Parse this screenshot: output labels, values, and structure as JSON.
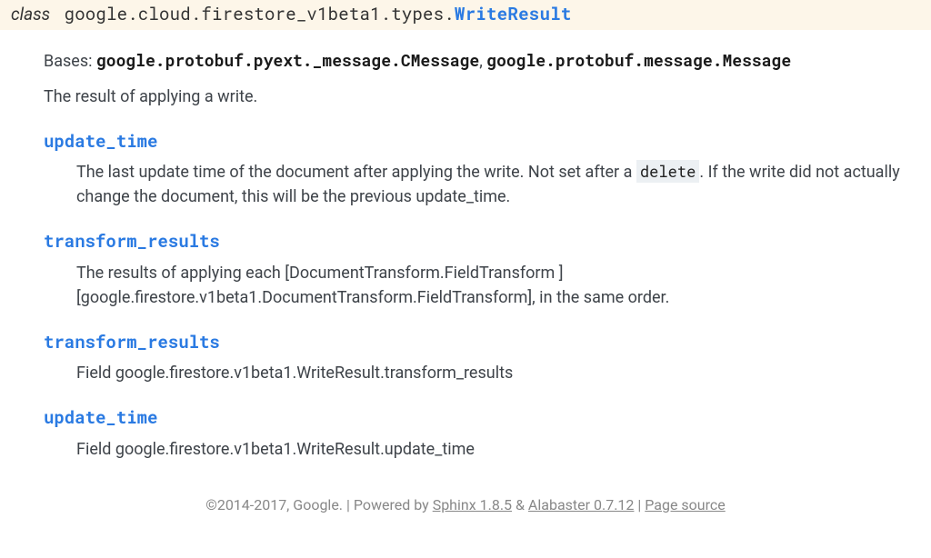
{
  "class_header": {
    "prefix": "class",
    "module_path": "google.cloud.firestore_v1beta1.types.",
    "class_name": "WriteResult"
  },
  "bases": {
    "label": "Bases:",
    "items": [
      "google.protobuf.pyext._message.CMessage",
      "google.protobuf.message.Message"
    ],
    "separator": ", "
  },
  "class_description": "The result of applying a write.",
  "attributes": [
    {
      "name": "update_time",
      "description_pre": "The last update time of the document after applying the write. Not set after a ",
      "literal": "delete",
      "description_post": ". If the write did not actually change the document, this will be the previous update_time."
    },
    {
      "name": "transform_results",
      "description": "The results of applying each [DocumentTransform.FieldTransform ][google.firestore.v1beta1.DocumentTransform.FieldTransform], in the same order."
    },
    {
      "name": "transform_results",
      "description": "Field google.firestore.v1beta1.WriteResult.transform_results"
    },
    {
      "name": "update_time",
      "description": "Field google.firestore.v1beta1.WriteResult.update_time"
    }
  ],
  "footer": {
    "copyright": "©2014-2017, Google.",
    "powered_by": "Powered by",
    "sphinx_label": "Sphinx 1.8.5",
    "amp": "&",
    "alabaster_label": "Alabaster 0.7.12",
    "page_source": "Page source"
  }
}
